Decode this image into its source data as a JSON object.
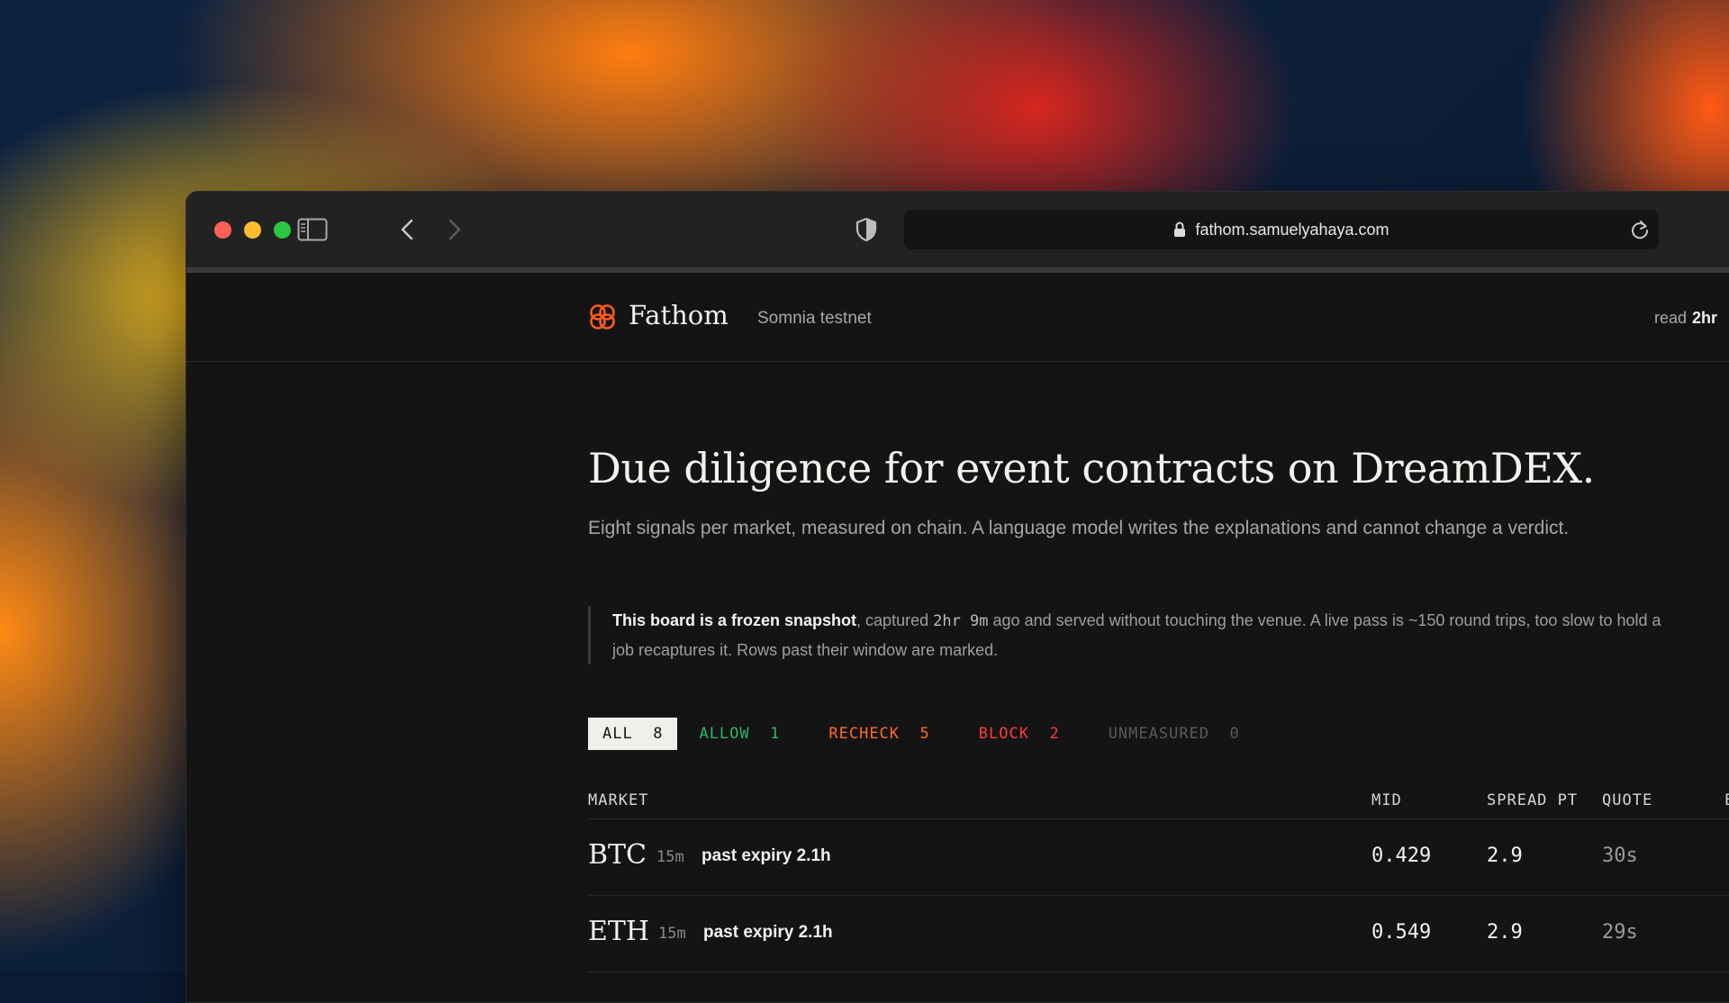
{
  "browser": {
    "url": "fathom.samuelyahaya.com"
  },
  "header": {
    "brand": "Fathom",
    "network": "Somnia testnet",
    "read_label": "read",
    "read_value": "2hr"
  },
  "hero": {
    "headline": "Due diligence for event contracts on DreamDEX.",
    "subhead": "Eight signals per market, measured on chain. A language model writes the explanations and cannot change a verdict."
  },
  "notice": {
    "strong": "This board is a frozen snapshot",
    "part1": ", captured ",
    "age": "2hr 9m",
    "part2": " ago and served without touching the venue. A live pass is ~150 round trips, too slow to hold a",
    "line2": "job recaptures it. Rows past their window are marked."
  },
  "filters": [
    {
      "label": "ALL",
      "count": "8",
      "type": "all"
    },
    {
      "label": "ALLOW",
      "count": "1",
      "type": "allow"
    },
    {
      "label": "RECHECK",
      "count": "5",
      "type": "recheck"
    },
    {
      "label": "BLOCK",
      "count": "2",
      "type": "block"
    },
    {
      "label": "UNMEASURED",
      "count": "0",
      "type": "unmeasured"
    }
  ],
  "table": {
    "columns": {
      "market": "MARKET",
      "mid": "MID",
      "spread": "SPREAD PT",
      "quote": "QUOTE",
      "edge": "E"
    },
    "rows": [
      {
        "market": "BTC",
        "window": "15m",
        "status": "past expiry 2.1h",
        "mid": "0.429",
        "spread": "2.9",
        "quote": "30s",
        "edge": "·"
      },
      {
        "market": "ETH",
        "window": "15m",
        "status": "past expiry 2.1h",
        "mid": "0.549",
        "spread": "2.9",
        "quote": "29s",
        "edge": "·"
      }
    ]
  },
  "colors": {
    "allow": "#2fb463",
    "recheck": "#ff6a2a",
    "block": "#ff3b3b",
    "unmeasured": "#5a5a5a",
    "logo": "#ff5a1f"
  }
}
